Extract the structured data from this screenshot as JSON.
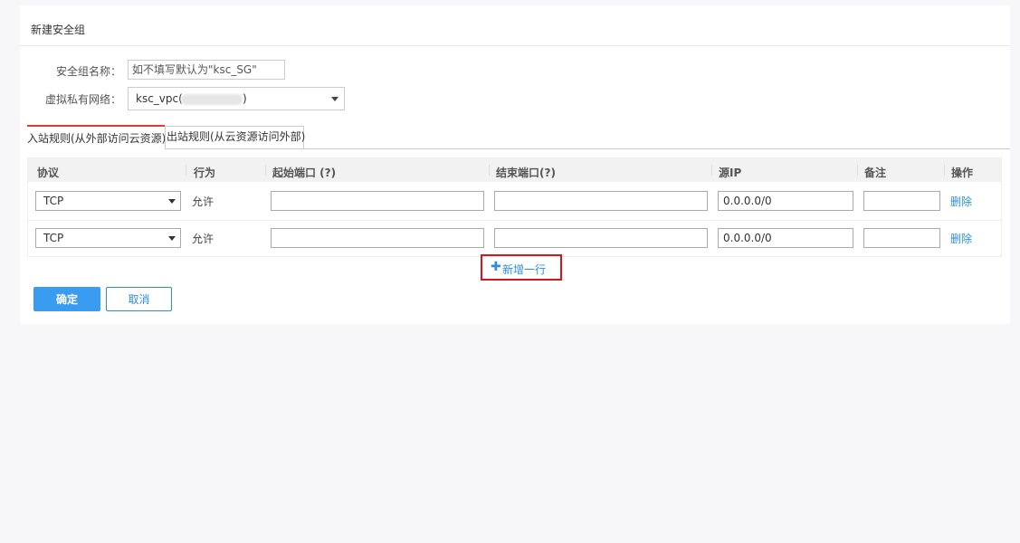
{
  "panel": {
    "title": "新建安全组"
  },
  "form": {
    "name_label": "安全组名称：",
    "name_placeholder": "如不填写默认为\"ksc_SG\"",
    "vpc_label": "虚拟私有网络：",
    "vpc_value_prefix": "ksc_vpc(",
    "vpc_value_suffix": ")"
  },
  "tabs": [
    {
      "label": "入站规则(从外部访问云资源)",
      "active": true
    },
    {
      "label": "出站规则(从云资源访问外部)",
      "active": false
    }
  ],
  "table": {
    "headers": {
      "protocol": "协议",
      "action": "行为",
      "start_port": "起始端口 (?)",
      "end_port": "结束端口(?)",
      "source_ip": "源IP",
      "remark": "备注",
      "operation": "操作"
    },
    "rows": [
      {
        "protocol": "TCP",
        "action": "允许",
        "start_port": "",
        "end_port": "",
        "source_ip": "0.0.0.0/0",
        "remark": "",
        "delete_label": "删除"
      },
      {
        "protocol": "TCP",
        "action": "允许",
        "start_port": "",
        "end_port": "",
        "source_ip": "0.0.0.0/0",
        "remark": "",
        "delete_label": "删除"
      }
    ]
  },
  "add_row": {
    "icon": "plus-icon",
    "label": "新增一行"
  },
  "buttons": {
    "confirm": "确定",
    "cancel": "取消"
  },
  "colors": {
    "accent": "#3a9cf0",
    "link": "#2b8fdf",
    "highlight_border": "#d9141b",
    "active_tab": "#e53935"
  }
}
